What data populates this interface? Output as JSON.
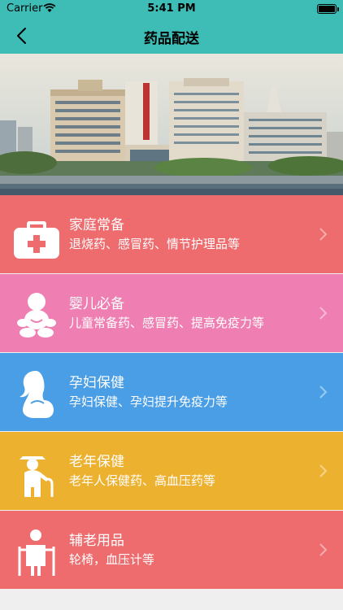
{
  "status_bar": {
    "carrier": "Carrier",
    "time": "5:41 PM"
  },
  "nav": {
    "title": "药品配送"
  },
  "banner": {
    "alt": "hospital-building-image"
  },
  "categories": [
    {
      "title": "家庭常备",
      "subtitle": "退烧药、感冒药、情节护理品等",
      "color": "#ee6b6e",
      "icon": "medical-kit-icon"
    },
    {
      "title": "婴儿必备",
      "subtitle": "儿童常备药、感冒药、提高免疫力等",
      "color": "#ef7fb2",
      "icon": "baby-icon"
    },
    {
      "title": "孕妇保健",
      "subtitle": "孕妇保健、孕妇提升免疫力等",
      "color": "#4a9ee6",
      "icon": "pregnant-woman-icon"
    },
    {
      "title": "老年保健",
      "subtitle": "老年人保健药、高血压药等",
      "color": "#edb130",
      "icon": "elderly-person-icon"
    },
    {
      "title": "辅老用品",
      "subtitle": "轮椅，血压计等",
      "color": "#ee6b6e",
      "icon": "walker-icon"
    }
  ]
}
